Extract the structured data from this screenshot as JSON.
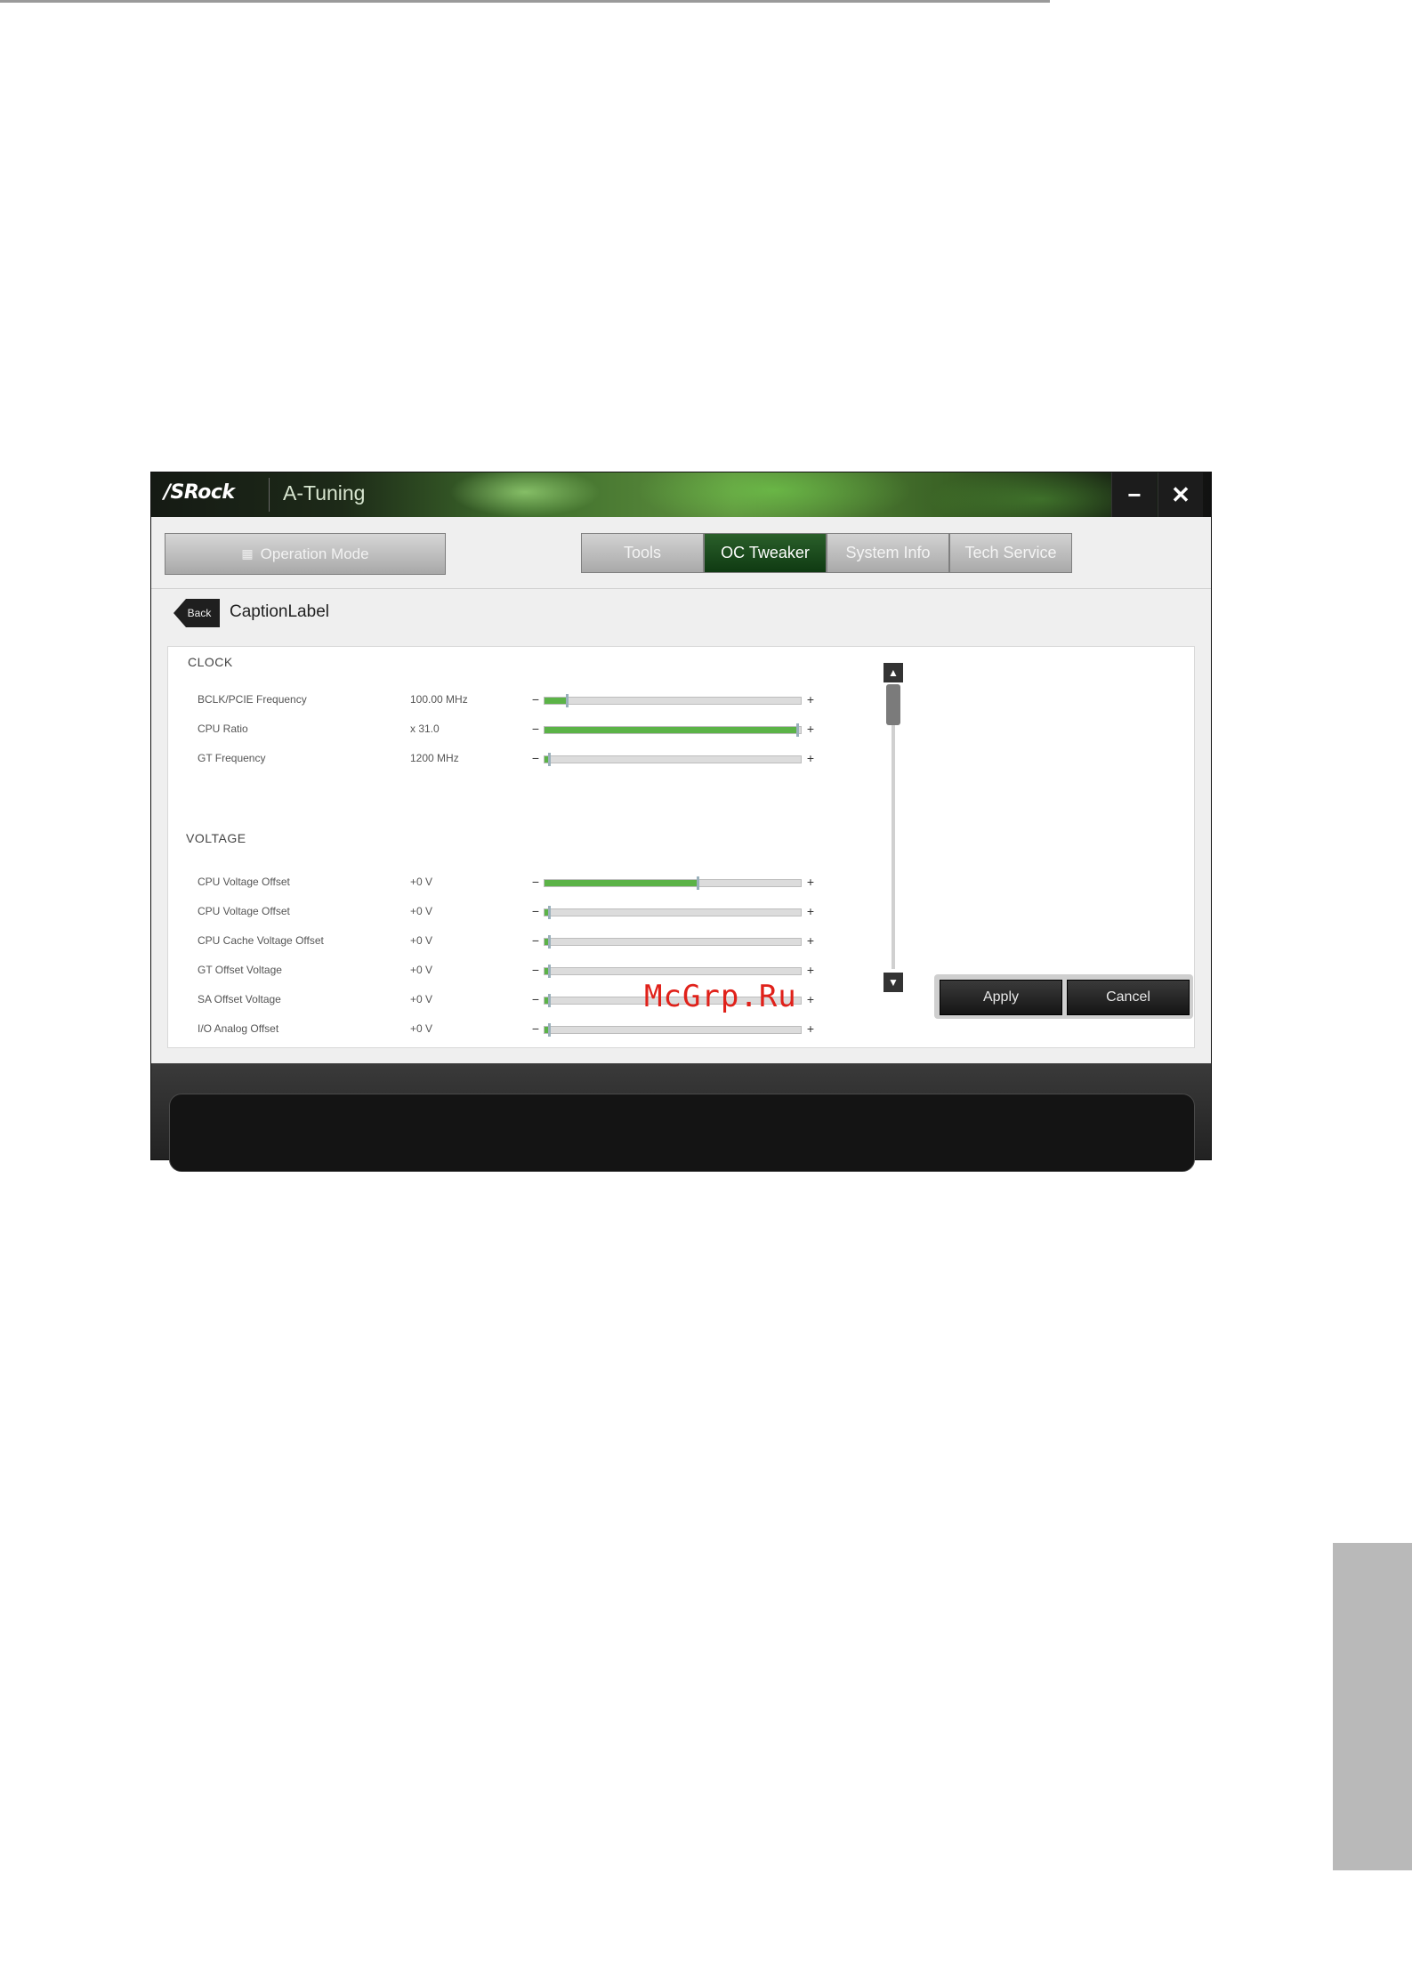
{
  "window": {
    "brand": "/SRock",
    "app_name": "A-Tuning"
  },
  "window_controls": {
    "minimize": "−",
    "close": "✕"
  },
  "toolbar": {
    "operation_mode": "Operation Mode"
  },
  "tabs": [
    {
      "label": "Tools",
      "active": false
    },
    {
      "label": "OC Tweaker",
      "active": true
    },
    {
      "label": "System Info",
      "active": false
    },
    {
      "label": "Tech Service",
      "active": false
    }
  ],
  "nav": {
    "back_label": "Back",
    "caption": "CaptionLabel"
  },
  "sections": {
    "clock": {
      "title": "CLOCK",
      "rows": [
        {
          "label": "BCLK/PCIE Frequency",
          "value": "100.00 MHz",
          "fill": 0.09
        },
        {
          "label": "CPU Ratio",
          "value": "x 31.0",
          "fill": 0.99
        },
        {
          "label": "GT Frequency",
          "value": "1200 MHz",
          "fill": 0.02
        }
      ]
    },
    "voltage": {
      "title": "VOLTAGE",
      "rows": [
        {
          "label": "CPU Voltage Offset",
          "value": "+0 V",
          "fill": 0.6
        },
        {
          "label": "CPU Voltage Offset",
          "value": "+0 V",
          "fill": 0.02
        },
        {
          "label": "CPU Cache Voltage Offset",
          "value": "+0 V",
          "fill": 0.02
        },
        {
          "label": "GT Offset Voltage",
          "value": "+0 V",
          "fill": 0.02
        },
        {
          "label": "SA Offset Voltage",
          "value": "+0 V",
          "fill": 0.02
        },
        {
          "label": "I/O Analog Offset",
          "value": "+0 V",
          "fill": 0.02
        }
      ]
    }
  },
  "stepper": {
    "minus": "−",
    "plus": "+"
  },
  "scroll": {
    "up": "▲",
    "down": "▼"
  },
  "actions": {
    "apply": "Apply",
    "cancel": "Cancel"
  },
  "watermark": "McGrp.Ru",
  "colors": {
    "accent_green": "#5bb347",
    "active_tab": "#1a4a1c"
  }
}
